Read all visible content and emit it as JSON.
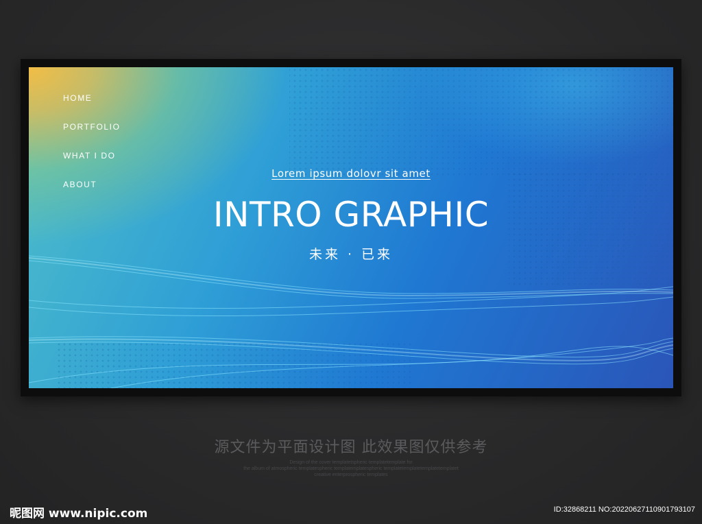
{
  "nav": {
    "items": [
      "HOME",
      "PORTFOLIO",
      "WHAT I DO",
      "ABOUT"
    ]
  },
  "hero": {
    "subtitle": "Lorem ipsum dolovr sit amet",
    "title": "INTRO GRAPHIC",
    "tagline": "未来 · 已来"
  },
  "footer": {
    "caption_cn": "源文件为平面设计图 此效果图仅供参考",
    "caption_en": [
      "Design of the cover templatetspheric templatetemplate for",
      "the album of atmospheric templatespheric templatemplatespheric templatetemplatetemplatetemplatet",
      "creative enterprospheric templates"
    ],
    "logo": "昵图网 www.nipic.com",
    "image_id": "ID:32868211 NO:20220627110901793107"
  },
  "colors": {
    "background": "#2a2a2b",
    "frame": "#0d0d0e",
    "gradient_top_left": "#f2bd45",
    "gradient_mid": "#1f78d2",
    "gradient_bottom_right": "#2a55b8"
  },
  "icons": {
    "logo": "nipic-logo"
  }
}
